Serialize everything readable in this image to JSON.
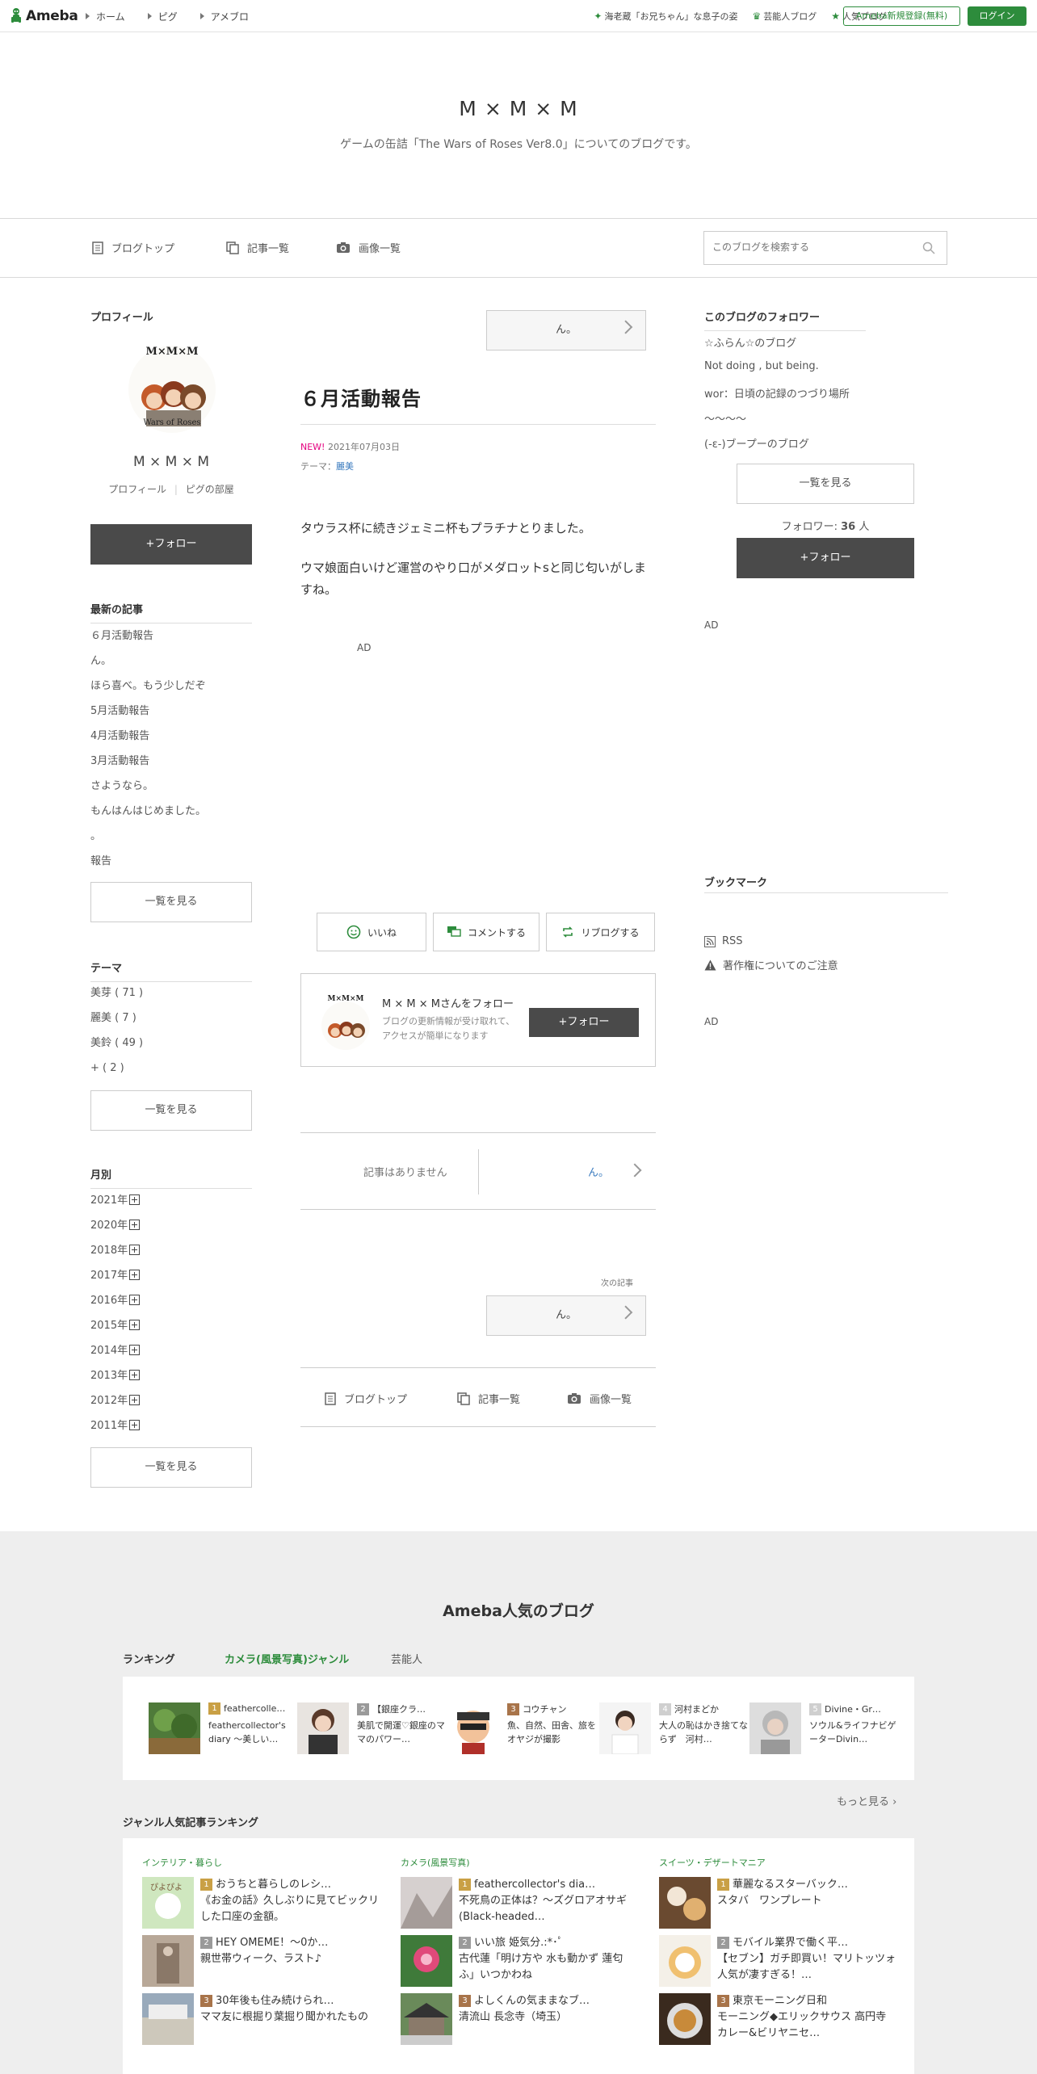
{
  "topbar": {
    "logo": "Ameba",
    "nav": [
      "ホーム",
      "ピグ",
      "アメブロ"
    ],
    "links": [
      "海老蔵「お兄ちゃん」な息子の姿",
      "芸能人ブログ",
      "人気ブログ"
    ],
    "register": "Ameba新規登録(無料)",
    "login": "ログイン"
  },
  "header": {
    "title": "M × M × M",
    "description": "ゲームの缶詰「The Wars of Roses Ver8.0」についてのブログです。"
  },
  "subnav": {
    "items": [
      "ブログトップ",
      "記事一覧",
      "画像一覧"
    ],
    "search_placeholder": "このブログを検索する"
  },
  "profile": {
    "heading": "プロフィール",
    "name": "M × M × M",
    "link_profile": "プロフィール",
    "link_room": "ピグの部屋",
    "follow": "+フォロー",
    "avatar_logo": "M×M×M",
    "avatar_sub": "Wars of Roses"
  },
  "recent": {
    "heading": "最新の記事",
    "items": [
      "６月活動報告",
      "ん。",
      "ほら喜べ。もう少しだぞ",
      "5月活動報告",
      "4月活動報告",
      "3月活動報告",
      "さようなら。",
      "もんはんはじめました。",
      "。",
      "報告"
    ],
    "more": "一覧を見る"
  },
  "themes": {
    "heading": "テーマ",
    "items": [
      "美芽 ( 71 )",
      "麗美 ( 7 )",
      "美鈴 ( 49 )",
      "+ ( 2 )"
    ],
    "more": "一覧を見る"
  },
  "monthly": {
    "heading": "月別",
    "years": [
      "2021年",
      "2020年",
      "2018年",
      "2017年",
      "2016年",
      "2015年",
      "2014年",
      "2013年",
      "2012年",
      "2011年"
    ],
    "more": "一覧を見る"
  },
  "entry": {
    "prev_top": "ん。",
    "title": "６月活動報告",
    "new_badge": "NEW!",
    "date": "2021年07月03日",
    "theme_label": "テーマ：",
    "theme": "麗美",
    "para1": "タウラス杯に続きジェミニ杯もプラチナとりました。",
    "para2": "ウマ娘面白いけど運営のやり口がメダロットsと同じ匂いがしますね。",
    "ad": "AD",
    "like": "いいね",
    "comment": "コメントする",
    "reblog": "リブログする",
    "follow_title": "M × M × Mさんをフォロー",
    "follow_desc": "ブログの更新情報が受け取れて、アクセスが簡単になります",
    "follow_btn": "+フォロー",
    "no_entry": "記事はありません",
    "next_link": "ん。",
    "next_label": "次の記事",
    "next_box": "ん。",
    "bottom_nav": [
      "ブログトップ",
      "記事一覧",
      "画像一覧"
    ]
  },
  "followers": {
    "heading": "このブログのフォロワー",
    "items": [
      "☆ふらん☆のブログ",
      "Not doing , but being.",
      "wor：日頃の記録のつづり場所",
      "～～～～",
      "(-ε-)ブープーのブログ"
    ],
    "more": "一覧を見る",
    "count_label": "フォロワー:",
    "count": "36",
    "count_unit": "人",
    "follow": "+フォロー",
    "ad": "AD"
  },
  "bookmark": {
    "heading": "ブックマーク",
    "rss": "RSS",
    "copyright": "著作権についてのご注意",
    "ad": "AD"
  },
  "footer": {
    "title": "Ameba人気のブログ",
    "ranking_label": "ランキング",
    "tabs": [
      "カメラ(風景写真)ジャンル",
      "芸能人"
    ],
    "ranking": [
      {
        "num": "1",
        "name": "feathercolle…",
        "desc": "feathercollector's diary 〜美しい…"
      },
      {
        "num": "2",
        "name": "【銀座クラ…",
        "desc": "美肌で開運♡銀座のママのパワー…"
      },
      {
        "num": "3",
        "name": "コウチャン",
        "desc": "魚、自然、田舎、旅をオヤジが撮影"
      },
      {
        "num": "4",
        "name": "河村まどか",
        "desc": "大人の恥はかき捨てならず　河村…"
      },
      {
        "num": "5",
        "name": "Divine・Gr…",
        "desc": "ソウル&ライフナビゲーターDivin…"
      }
    ],
    "more": "もっと見る",
    "genre_heading": "ジャンル人気記事ランキング",
    "genres": [
      {
        "name": "インテリア・暮らし",
        "items": [
          {
            "num": "1",
            "title": "おうちと暮らしのレシ…",
            "desc": "《お金の話》久しぶりに見てビックリした口座の金額。"
          },
          {
            "num": "2",
            "title": "HEY OMEME！〜0か…",
            "desc": "親世帯ウィーク、ラスト♪"
          },
          {
            "num": "3",
            "title": "30年後も住み続けられ…",
            "desc": "ママ友に根掘り葉掘り聞かれたもの"
          }
        ]
      },
      {
        "name": "カメラ(風景写真)",
        "items": [
          {
            "num": "1",
            "title": "feathercollector's dia…",
            "desc": "不死鳥の正体は？～ズグロアオサギ(Black-headed…"
          },
          {
            "num": "2",
            "title": "いい旅 姫気分.:*･ﾟ",
            "desc": "古代蓮「明け方や 水も動かず 蓮匂ふ」いつかわね"
          },
          {
            "num": "3",
            "title": "よしくんの気ままなブ…",
            "desc": "清流山 長念寺（埼玉）"
          }
        ]
      },
      {
        "name": "スイーツ・デザートマニア",
        "items": [
          {
            "num": "1",
            "title": "華麗なるスターバック…",
            "desc": "スタバ　ワンプレート"
          },
          {
            "num": "2",
            "title": "モバイル業界で働く平…",
            "desc": "【セブン】ガチ即買い！マリトッツォ人気が凄すぎる！…"
          },
          {
            "num": "3",
            "title": "東京モーニング日和",
            "desc": "モーニング◆エリックサウス 高円寺カレー&ビリヤニセ…"
          }
        ]
      }
    ]
  },
  "colors": {
    "green": "#2d8c3c",
    "rank1": "#c9a045",
    "rank2": "#9a9a9a",
    "rank3": "#a8744a"
  }
}
